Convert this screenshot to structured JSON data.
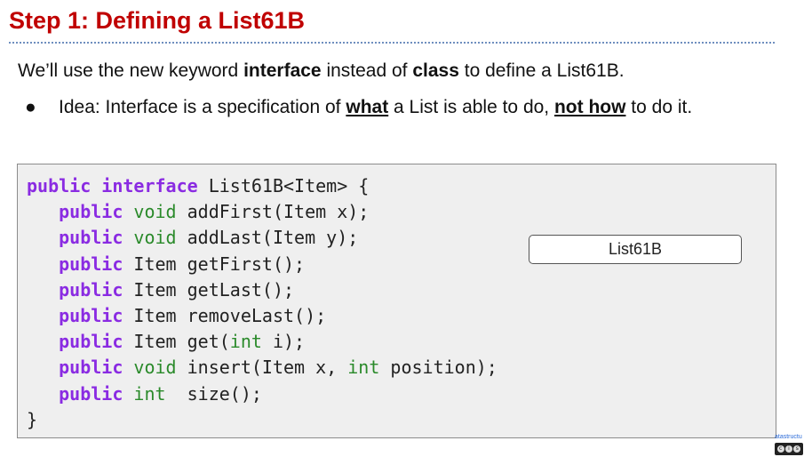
{
  "slide": {
    "title": "Step 1: Defining a List61B",
    "intro": {
      "part1": "We’ll use the new keyword ",
      "bold1": "interface",
      "part2": " instead of ",
      "bold2": "class",
      "part3": " to define a List61B."
    },
    "bullet": {
      "marker": "●",
      "part1": "Idea: Interface is a specification of ",
      "link1": "what",
      "part2": " a List is able to do, ",
      "link2": "not how",
      "part3": " to do it."
    }
  },
  "code": {
    "open_kw1": "public",
    "open_kw2": "interface",
    "open_rest": " List61B<Item> {",
    "lines": [
      {
        "kw": "public",
        "type": "void",
        "rest": " addFirst(Item x);"
      },
      {
        "kw": "public",
        "type": "void",
        "rest": " addLast(Item y);"
      },
      {
        "kw": "public",
        "plain": " Item getFirst();"
      },
      {
        "kw": "public",
        "plain": " Item getLast();"
      },
      {
        "kw": "public",
        "plain": " Item removeLast();"
      },
      {
        "kw": "public",
        "plain": " Item get(",
        "type": "int",
        "rest": " i);"
      },
      {
        "kw": "public",
        "type": "void",
        "rest": " insert(Item x, ",
        "type2": "int",
        "rest2": " position);"
      },
      {
        "kw": "public",
        "type": "int",
        "rest": "  size();"
      }
    ],
    "close": "}"
  },
  "diagram": {
    "box_label": "List61B"
  },
  "footer": {
    "text": "atastructu",
    "license_icon": "cc-by-sa-icon"
  },
  "colors": {
    "title": "#c00000",
    "keyword": "#8a2be2",
    "type": "#2a8a2a"
  }
}
